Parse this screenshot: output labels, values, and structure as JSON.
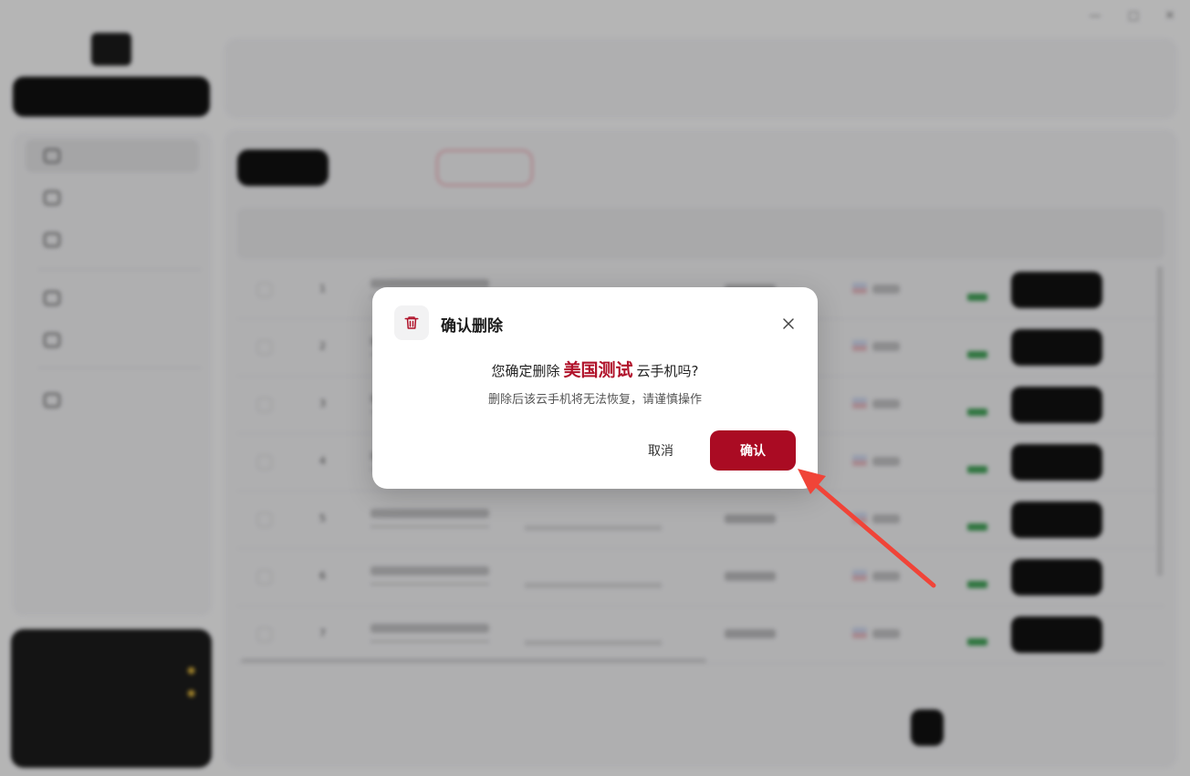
{
  "dialog": {
    "title": "确认删除",
    "message_prefix": "您确定删除",
    "device_name": "美国测试",
    "message_suffix": "云手机吗?",
    "warning": "删除后该云手机将无法恢复，请谨慎操作",
    "cancel_label": "取消",
    "confirm_label": "确认",
    "icons": {
      "header": "trash-icon",
      "close": "close-icon"
    },
    "colors": {
      "accent": "#aa0b23",
      "highlight": "#b0122a"
    }
  },
  "annotation": {
    "arrow_color": "#f04438"
  },
  "background": {
    "table_rows": [
      "1",
      "2",
      "3",
      "4",
      "5",
      "6",
      "7"
    ]
  }
}
